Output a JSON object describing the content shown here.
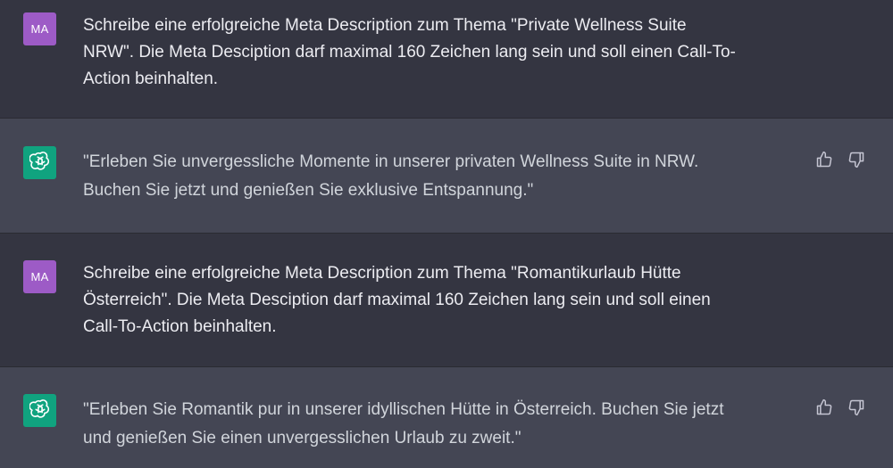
{
  "colors": {
    "user_bg": "#343541",
    "assistant_bg": "#444654",
    "user_avatar": "#9d5bc6",
    "assistant_avatar": "#10a37f"
  },
  "messages": [
    {
      "role": "user",
      "avatar": "MA",
      "text": "Schreibe eine erfolgreiche Meta Description zum Thema \"Private Wellness Suite\nNRW\". Die Meta Desciption darf maximal 160 Zeichen lang sein und soll einen Call-To-\nAction beinhalten."
    },
    {
      "role": "assistant",
      "avatar_icon": "chatgpt-logo-icon",
      "text": "\"Erleben Sie unvergessliche Momente in unserer privaten Wellness Suite in NRW.\nBuchen Sie jetzt und genießen Sie exklusive Entspannung.\"",
      "actions": [
        "thumbs-up-icon",
        "thumbs-down-icon"
      ]
    },
    {
      "role": "user",
      "avatar": "MA",
      "text": "Schreibe eine erfolgreiche Meta Description zum Thema \"Romantikurlaub Hütte\nÖsterreich\". Die Meta Desciption darf maximal 160 Zeichen lang sein und soll einen\nCall-To-Action beinhalten."
    },
    {
      "role": "assistant",
      "avatar_icon": "chatgpt-logo-icon",
      "text": "\"Erleben Sie Romantik pur in unserer idyllischen Hütte in Österreich. Buchen Sie jetzt\nund genießen Sie einen unvergesslichen Urlaub zu zweit.\"",
      "actions": [
        "thumbs-up-icon",
        "thumbs-down-icon"
      ]
    }
  ]
}
